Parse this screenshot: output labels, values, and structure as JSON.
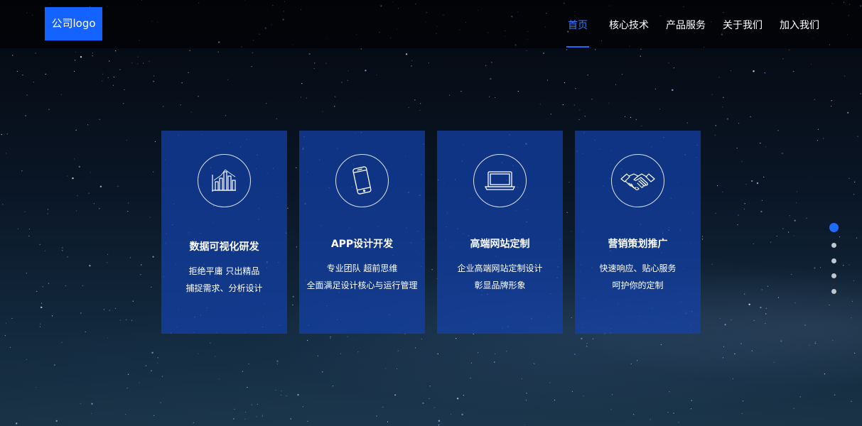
{
  "header": {
    "logo_text": "公司logo",
    "nav": [
      "首页",
      "核心技术",
      "产品服务",
      "关于我们",
      "加入我们"
    ],
    "active_index": 0
  },
  "cards": [
    {
      "icon": "bar-chart-icon",
      "title": "数据可视化研发",
      "lines": [
        "拒绝平庸  只出精品",
        "捕捉需求、分析设计"
      ]
    },
    {
      "icon": "smartphone-icon",
      "title": "APP设计开发",
      "lines": [
        "专业团队  超前思维",
        "全面满足设计核心与运行管理"
      ]
    },
    {
      "icon": "laptop-icon",
      "title": "高端网站定制",
      "lines": [
        "企业高端网站定制设计",
        "彰显品牌形象"
      ]
    },
    {
      "icon": "handshake-icon",
      "title": "营销策划推广",
      "lines": [
        "快速响应、贴心服务",
        "呵护你的定制"
      ]
    }
  ],
  "pagination": {
    "count": 5,
    "active_index": 0
  },
  "colors": {
    "accent": "#1462ff",
    "active_nav": "#2f7bff",
    "card_bg": "#1441aa"
  }
}
